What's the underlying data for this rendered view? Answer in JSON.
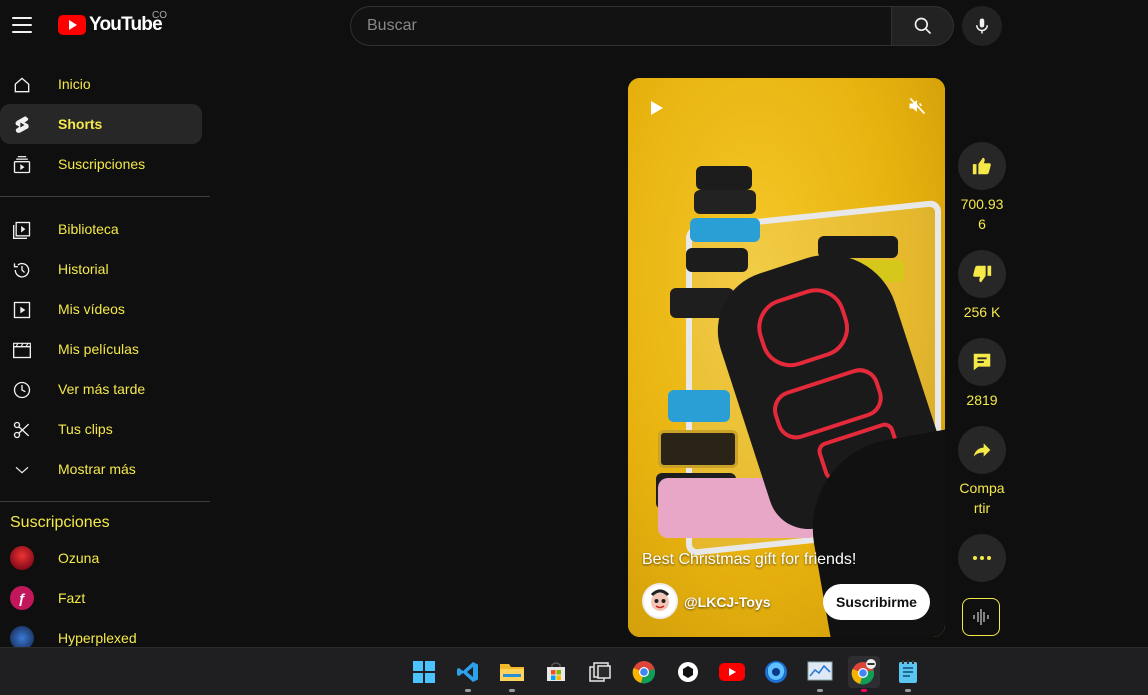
{
  "header": {
    "logo_text": "YouTube",
    "region": "CO",
    "search_placeholder": "Buscar"
  },
  "sidebar": {
    "main": [
      {
        "label": "Inicio",
        "icon": "home-icon"
      },
      {
        "label": "Shorts",
        "icon": "shorts-icon",
        "active": true
      },
      {
        "label": "Suscripciones",
        "icon": "subscriptions-icon"
      }
    ],
    "library": [
      {
        "label": "Biblioteca",
        "icon": "library-icon"
      },
      {
        "label": "Historial",
        "icon": "history-icon"
      },
      {
        "label": "Mis vídeos",
        "icon": "my-videos-icon"
      },
      {
        "label": "Mis películas",
        "icon": "movies-icon"
      },
      {
        "label": "Ver más tarde",
        "icon": "watch-later-icon"
      },
      {
        "label": "Tus clips",
        "icon": "clips-icon"
      },
      {
        "label": "Mostrar más",
        "icon": "chevron-down-icon"
      }
    ],
    "subscriptions_title": "Suscripciones",
    "subscriptions": [
      {
        "label": "Ozuna",
        "color": "#b0182a"
      },
      {
        "label": "Fazt",
        "color": "#c2185b"
      },
      {
        "label": "Hyperplexed",
        "color": "#1e3a6e"
      }
    ]
  },
  "short": {
    "caption": "Best Christmas gift for friends!",
    "channel": "@LKCJ-Toys",
    "subscribe_label": "Suscribirme"
  },
  "actions": {
    "likes": "700.93\n6",
    "likes_line1": "700.93",
    "likes_line2": "6",
    "dislikes": "256 K",
    "comments": "2819",
    "share_line1": "Compa",
    "share_line2": "rtir"
  },
  "colors": {
    "accent_text": "#f5e94a",
    "brand_red": "#ff0000",
    "background": "#0f0f0f"
  },
  "taskbar": {
    "apps": [
      "windows-start-icon",
      "vscode-icon",
      "file-explorer-icon",
      "microsoft-store-icon",
      "task-view-icon",
      "chrome-icon",
      "app-icon",
      "youtube-app-icon",
      "firefox-icon",
      "resource-monitor-icon",
      "chrome-profile-icon",
      "notepad-icon"
    ]
  }
}
